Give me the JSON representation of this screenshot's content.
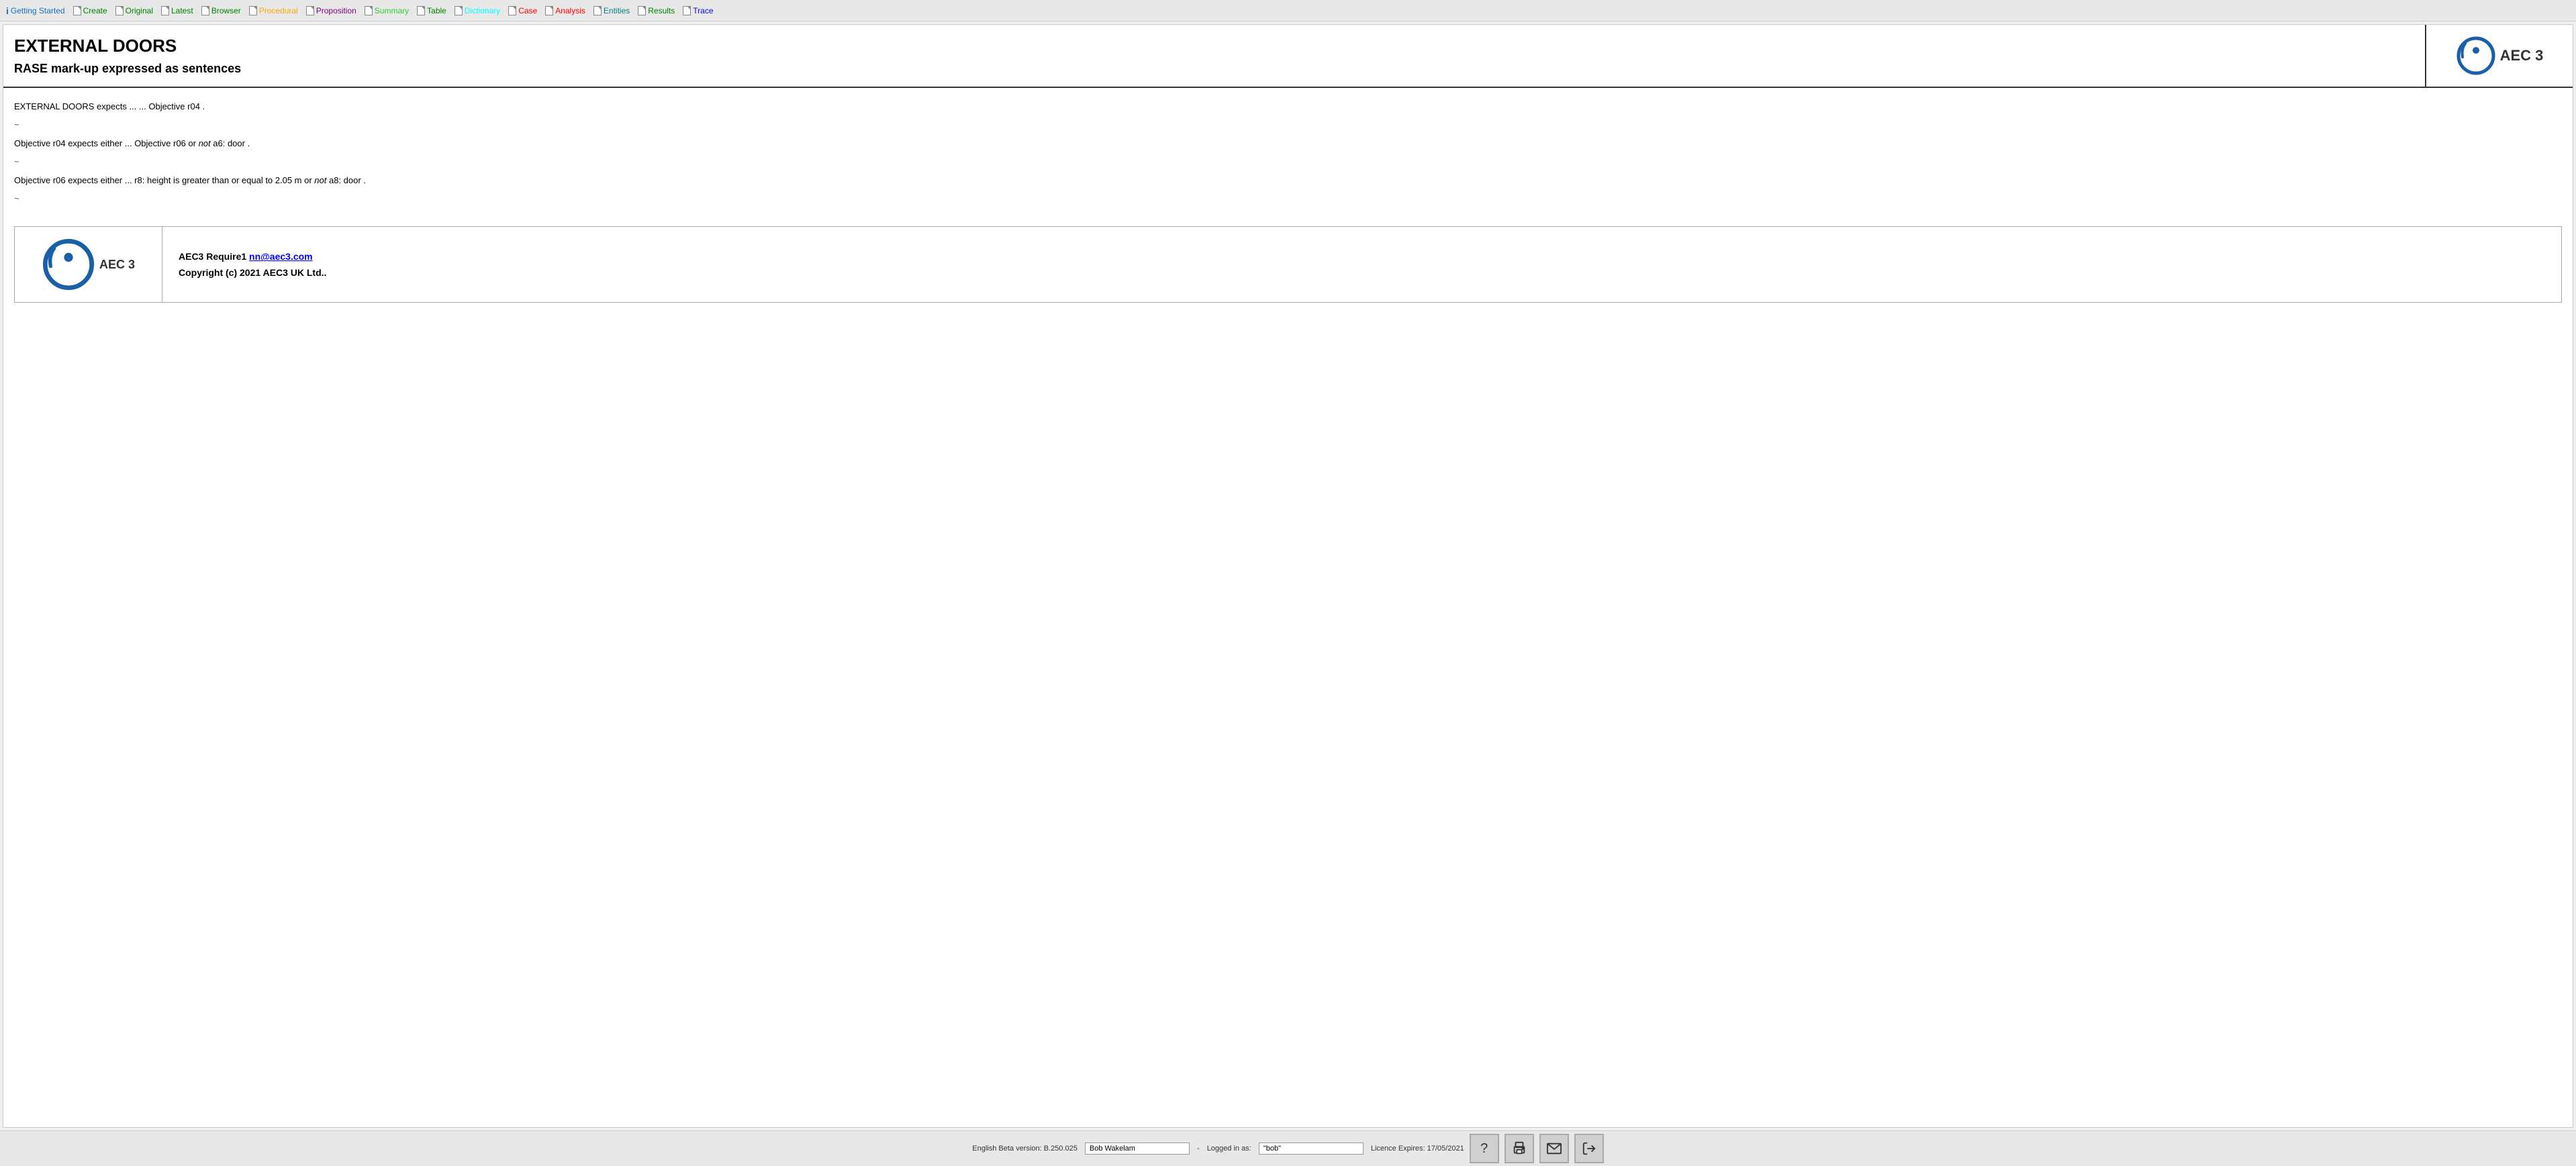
{
  "navbar": {
    "items": [
      {
        "id": "getting-started",
        "label": "Getting Started",
        "color": "color-info",
        "icon": "ℹ",
        "isInfo": true
      },
      {
        "id": "create",
        "label": "Create",
        "color": "color-green",
        "icon": "doc"
      },
      {
        "id": "original",
        "label": "Original",
        "color": "color-green",
        "icon": "doc"
      },
      {
        "id": "latest",
        "label": "Latest",
        "color": "color-green",
        "icon": "doc"
      },
      {
        "id": "browser",
        "label": "Browser",
        "color": "color-green",
        "icon": "doc"
      },
      {
        "id": "procedural",
        "label": "Procedural",
        "color": "color-orange",
        "icon": "doc"
      },
      {
        "id": "proposition",
        "label": "Proposition",
        "color": "color-purple",
        "icon": "doc"
      },
      {
        "id": "summary",
        "label": "Summary",
        "color": "color-lime",
        "icon": "doc"
      },
      {
        "id": "table",
        "label": "Table",
        "color": "color-green",
        "icon": "doc"
      },
      {
        "id": "dictionary",
        "label": "Dictionary",
        "color": "color-cyan",
        "icon": "doc"
      },
      {
        "id": "case",
        "label": "Case",
        "color": "color-red",
        "icon": "doc"
      },
      {
        "id": "analysis",
        "label": "Analysis",
        "color": "color-red",
        "icon": "doc"
      },
      {
        "id": "entities",
        "label": "Entities",
        "color": "color-teal",
        "icon": "doc"
      },
      {
        "id": "results",
        "label": "Results",
        "color": "color-green",
        "icon": "doc"
      },
      {
        "id": "trace",
        "label": "Trace",
        "color": "color-blue",
        "icon": "doc"
      }
    ]
  },
  "header": {
    "title": "EXTERNAL DOORS",
    "subtitle": "RASE mark-up expressed as sentences"
  },
  "content": {
    "lines": [
      {
        "id": "line1",
        "text": "EXTERNAL DOORS expects ... ... Objective r04 .",
        "italic_word": ""
      },
      {
        "id": "tilde1",
        "text": "~",
        "tilde": true
      },
      {
        "id": "line2",
        "text": "Objective r04 expects either ... Objective r06 or ",
        "italic_word": "not",
        "after": " a6: door ."
      },
      {
        "id": "tilde2",
        "text": "~",
        "tilde": true
      },
      {
        "id": "line3",
        "text": "Objective r06 expects either ... r8: height is greater than or equal to 2.05 m or ",
        "italic_word": "not",
        "after": " a8: door ."
      },
      {
        "id": "tilde3",
        "text": "~",
        "tilde": true
      }
    ]
  },
  "footer_card": {
    "company": "AEC3 Require1",
    "email": "nn@aec3.com",
    "copyright": "Copyright (c) 2021 AEC3 UK Ltd.."
  },
  "bottom_bar": {
    "version_label": "English Beta version: B.250.025",
    "user_label": "Bob Wakelam",
    "separator": "-",
    "logged_in_label": "Logged in as:",
    "username_value": "\"bob\"",
    "licence_label": "Licence Expires: 17/05/2021",
    "buttons": [
      {
        "id": "help",
        "icon": "?",
        "label": "Help"
      },
      {
        "id": "print",
        "icon": "🖨",
        "label": "Print"
      },
      {
        "id": "email",
        "icon": "✉",
        "label": "Email"
      },
      {
        "id": "exit",
        "icon": "➜",
        "label": "Exit"
      }
    ]
  }
}
